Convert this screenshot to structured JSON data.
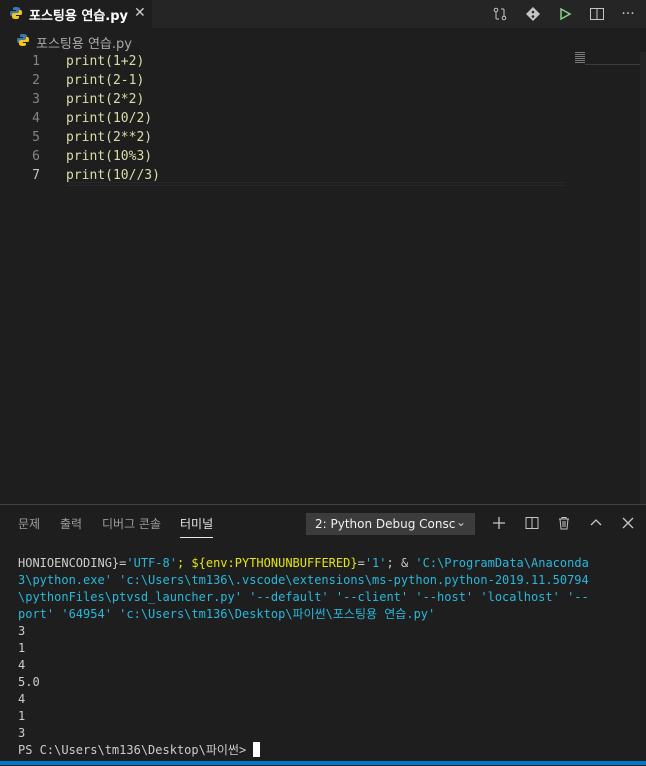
{
  "tab": {
    "title": "포스팅용 연습.py"
  },
  "breadcrumb": {
    "file": "포스팅용 연습.py"
  },
  "editor": {
    "lines": [
      {
        "num": "1",
        "text": "print(1+2)"
      },
      {
        "num": "2",
        "text": "print(2-1)"
      },
      {
        "num": "3",
        "text": "print(2*2)"
      },
      {
        "num": "4",
        "text": "print(10/2)"
      },
      {
        "num": "5",
        "text": "print(2**2)"
      },
      {
        "num": "6",
        "text": "print(10%3)"
      },
      {
        "num": "7",
        "text": "print(10//3)"
      }
    ]
  },
  "panel": {
    "tabs": [
      "문제",
      "출력",
      "디버그 콘솔",
      "터미널"
    ],
    "active_tab": "터미널",
    "terminal_selector": "2: Python Debug Consc"
  },
  "terminal": {
    "cmd": [
      {
        "p1": "HONIOENCODING",
        "p2": "}=",
        "p3": "'UTF-8'",
        "p4": "; ${env:PYTHONUNBUFFERED}",
        "p5": "=",
        "p6": "'1'",
        "p7": "; & ",
        "p8": "'C:\\ProgramData\\Anaconda"
      },
      {
        "text": "3\\python.exe' 'c:\\Users\\tm136\\.vscode\\extensions\\ms-python.python-2019.11.50794"
      },
      {
        "text": "\\pythonFiles\\ptvsd_launcher.py' '--default' '--client' '--host' 'localhost' '--"
      },
      {
        "text": "port' '64954' 'c:\\Users\\tm136\\Desktop\\파이썬\\포스팅용 연습.py'"
      }
    ],
    "output": [
      "3",
      "1",
      "4",
      "5.0",
      "4",
      "1",
      "3"
    ],
    "prompt": "PS C:\\Users\\tm136\\Desktop\\파이썬>"
  },
  "colors": {
    "accent": "#007acc",
    "function": "#dcdcaa",
    "terminal_string": "#29b8db"
  }
}
